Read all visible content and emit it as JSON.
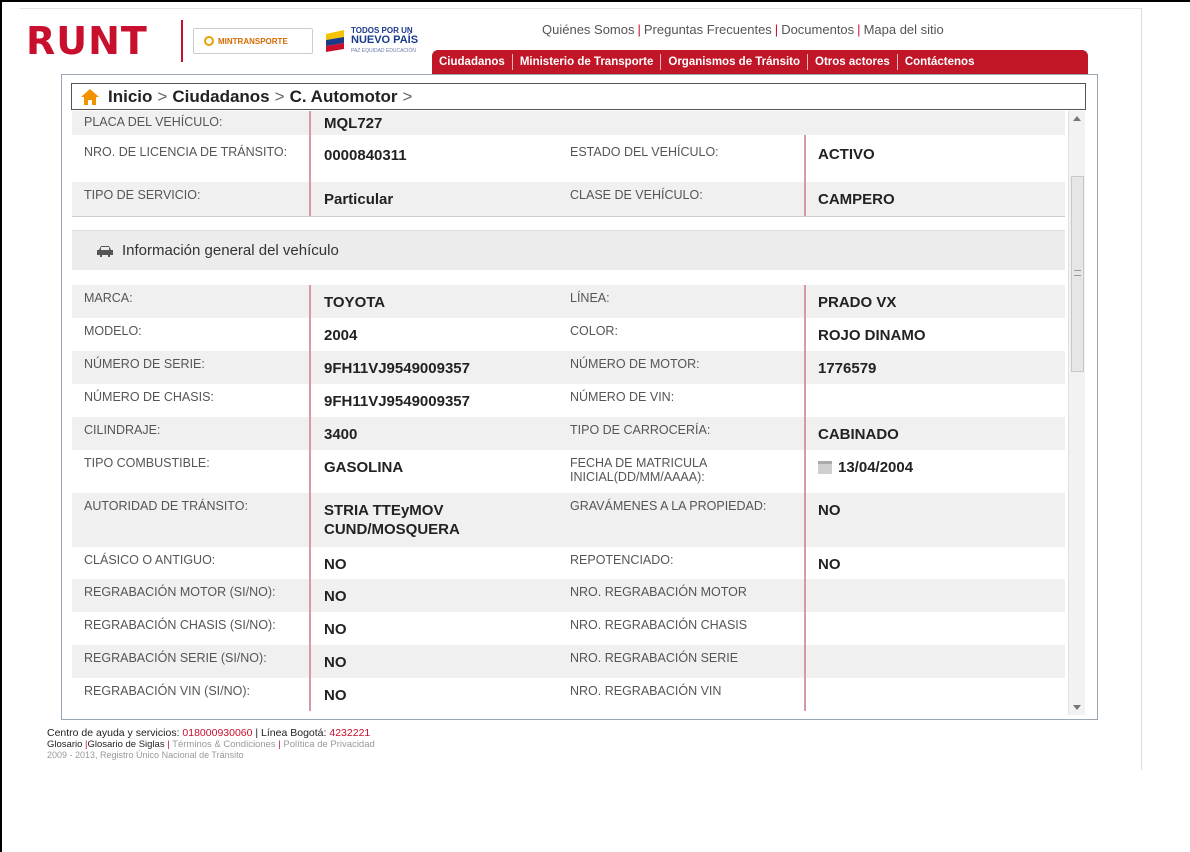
{
  "header": {
    "logo_runt": "RUNT",
    "logo_mintransporte": "MINTRANSPORTE",
    "logo_nuevo_line1": "TODOS POR UN",
    "logo_nuevo_line2": "NUEVO PAÍS",
    "logo_nuevo_line3": "PAZ  EQUIDAD  EDUCACIÓN",
    "top_links": [
      "Quiénes Somos",
      "Preguntas Frecuentes",
      "Documentos",
      "Mapa del sitio"
    ],
    "nav": [
      "Ciudadanos",
      "Ministerio de Transporte",
      "Organismos de Tránsito",
      "Otros actores",
      "Contáctenos"
    ]
  },
  "breadcrumb": {
    "home": "Inicio",
    "level1": "Ciudadanos",
    "level2": "C. Automotor",
    "sep": ">"
  },
  "top_rows": [
    {
      "label1": "PLACA DEL VEHÍCULO:",
      "value1": "MQL727",
      "label2": "",
      "value2": ""
    },
    {
      "label1": "NRO. DE LICENCIA DE TRÁNSITO:",
      "value1": "0000840311",
      "label2": "ESTADO DEL VEHÍCULO:",
      "value2": "ACTIVO"
    },
    {
      "label1": "TIPO DE SERVICIO:",
      "value1": "Particular",
      "label2": "CLASE DE VEHÍCULO:",
      "value2": "CAMPERO"
    }
  ],
  "section": {
    "title": "Información general del vehículo",
    "icon": "car-icon"
  },
  "rows": [
    {
      "label1": "MARCA:",
      "value1": "TOYOTA",
      "label2": "LÍNEA:",
      "value2": "PRADO VX"
    },
    {
      "label1": "MODELO:",
      "value1": "2004",
      "label2": "COLOR:",
      "value2": "ROJO DINAMO"
    },
    {
      "label1": "NÚMERO DE SERIE:",
      "value1": "9FH11VJ9549009357",
      "label2": "NÚMERO DE MOTOR:",
      "value2": "1776579"
    },
    {
      "label1": "NÚMERO DE CHASIS:",
      "value1": "9FH11VJ9549009357",
      "label2": "NÚMERO DE VIN:",
      "value2": ""
    },
    {
      "label1": "CILINDRAJE:",
      "value1": "3400",
      "label2": "TIPO DE CARROCERÍA:",
      "value2": "CABINADO"
    },
    {
      "label1": "TIPO COMBUSTIBLE:",
      "value1": "GASOLINA",
      "label2": "FECHA DE MATRICULA INICIAL(DD/MM/AAAA):",
      "value2": "13/04/2004"
    },
    {
      "label1": "AUTORIDAD DE TRÁNSITO:",
      "value1": "STRIA TTEyMOV CUND/MOSQUERA",
      "label2": "GRAVÁMENES A LA PROPIEDAD:",
      "value2": "NO"
    },
    {
      "label1": "CLÁSICO O ANTIGUO:",
      "value1": "NO",
      "label2": "REPOTENCIADO:",
      "value2": "NO"
    },
    {
      "label1": "REGRABACIÓN MOTOR (SI/NO):",
      "value1": "NO",
      "label2": "NRO. REGRABACIÓN MOTOR",
      "value2": ""
    },
    {
      "label1": "REGRABACIÓN CHASIS (SI/NO):",
      "value1": "NO",
      "label2": "NRO. REGRABACIÓN CHASIS",
      "value2": ""
    },
    {
      "label1": "REGRABACIÓN SERIE (SI/NO):",
      "value1": "NO",
      "label2": "NRO. REGRABACIÓN SERIE",
      "value2": ""
    },
    {
      "label1": "REGRABACIÓN VIN (SI/NO):",
      "value1": "NO",
      "label2": "NRO. REGRABACIÓN VIN",
      "value2": ""
    }
  ],
  "footer": {
    "help_text": "Centro de ayuda y servicios:",
    "help_phone": "018000930060",
    "bogota_text": "| Línea Bogotá:",
    "bogota_phone": "4232221",
    "link_glosario": "Glosario",
    "link_siglas": "Glosario de Siglas",
    "link_terminos": "Términos & Condiciones",
    "link_privacidad": "Política de Privacidad",
    "copyright": "2009 - 2013, Registro Único Nacional de Tránsito"
  },
  "colors": {
    "brand_red": "#c01628",
    "value_border": "#d79aa2",
    "odd_row": "#f0f0f0"
  }
}
